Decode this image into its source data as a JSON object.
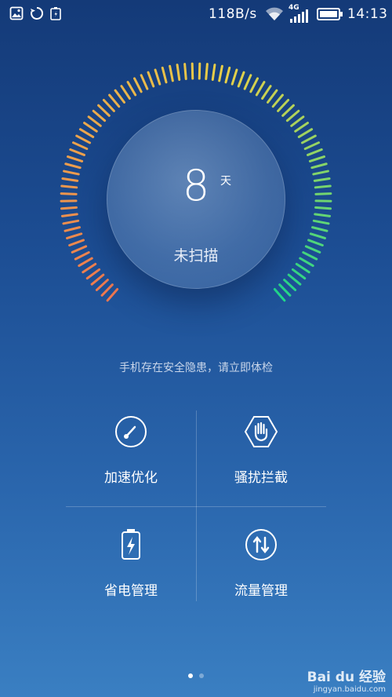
{
  "status_bar": {
    "speed": "118B/s",
    "network": "4G",
    "time": "14:13"
  },
  "scan": {
    "days": "8",
    "unit": "天",
    "status": "未扫描"
  },
  "warning": "手机存在安全隐患，请立即体检",
  "tiles": [
    {
      "label": "加速优化",
      "icon": "speed-dial-icon"
    },
    {
      "label": "骚扰拦截",
      "icon": "hand-shield-icon"
    },
    {
      "label": "省电管理",
      "icon": "battery-icon"
    },
    {
      "label": "流量管理",
      "icon": "data-arrows-icon"
    }
  ],
  "pager": {
    "current": 1,
    "total": 2
  },
  "watermark": {
    "brand": "Bai du 经验",
    "url": "jingyan.baidu.com"
  },
  "colors": {
    "arc_start": "#f07850",
    "arc_mid": "#e8d048",
    "arc_end": "#22d88a"
  }
}
